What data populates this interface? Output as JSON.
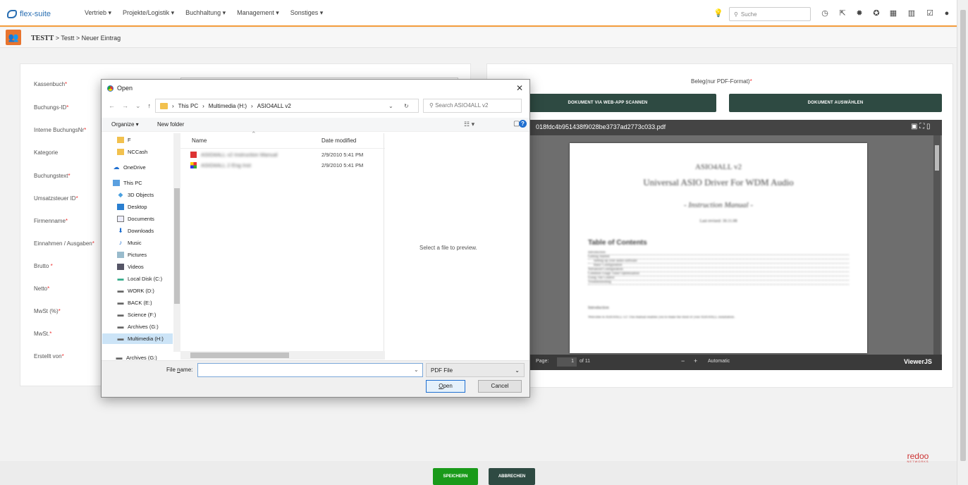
{
  "app": {
    "logo_text": "flex-suite",
    "menu": [
      "Vertrieb ▾",
      "Projekte/Logistik ▾",
      "Buchhaltung ▾",
      "Management ▾",
      "Sonstiges ▾"
    ],
    "search_placeholder": "Suche"
  },
  "breadcrumb": {
    "module": "TESTT",
    "trail": " > Testt > Neuer Eintrag"
  },
  "form": {
    "labels": [
      "Kassenbuch",
      "Buchungs-ID",
      "Interne BuchungsNr",
      "Kategorie",
      "Buchungstext",
      "Umsatzsteuer ID",
      "Firmenname",
      "Einnahmen / Ausgaben",
      "Brutto ",
      "Netto",
      "MwSt (%)",
      "MwSt.",
      "Erstellt von"
    ],
    "required_marker": "*"
  },
  "beleg": {
    "label": "Beleg(nur PDF-Format)",
    "scan_button": "DOKUMENT VIA WEB-APP SCANNEN",
    "select_button": "DOKUMENT AUSWÄHLEN"
  },
  "viewer": {
    "filename": "018fdc4b951438f9028be3737ad2773c033.pdf",
    "page_label": "Page:",
    "page_num": "1",
    "page_of": "of 11",
    "zoom": "Automatic",
    "brand": "ViewerJS",
    "doc_title1": "ASIO4ALL v2",
    "doc_title2": "Universal ASIO Driver For WDM Audio",
    "doc_subtitle": "- Instruction Manual -",
    "doc_revised": "Last revised: 30.11.08",
    "toc_heading": "Table of Contents",
    "toc_lines": [
      "Introduction",
      "Getting Started",
      "Setting up your audio software",
      "Basic Configuration",
      "Advanced Configuration",
      "Common Usage Tuner Optimization",
      "Using The Control",
      "Troubleshooting"
    ],
    "intro_heading": "Introduction",
    "intro_text": "Welcome to ASIO4ALL v2! This manual enables you to make the most of your ASIO4ALL installation."
  },
  "dialog": {
    "title": "Open",
    "path": [
      "This PC",
      "Multimedia (H:)",
      "ASIO4ALL v2"
    ],
    "search_placeholder": "Search ASIO4ALL v2",
    "organize": "Organize ▾",
    "new_folder": "New folder",
    "col_name": "Name",
    "col_date": "Date modified",
    "tree": [
      "F",
      "NCCash",
      "OneDrive",
      "This PC",
      "3D Objects",
      "Desktop",
      "Documents",
      "Downloads",
      "Music",
      "Pictures",
      "Videos",
      "Local Disk (C:)",
      "WORK (D:)",
      "BACK (E:)",
      "Science (F:)",
      "Archives (G:)",
      "Multimedia (H:)"
    ],
    "tree_footer": "Archives (G:)",
    "files": [
      {
        "name": "ASIO4ALL v2 Instruction Manual",
        "date": "2/9/2010 5:41 PM"
      },
      {
        "name": "ASIO4ALL 2 Eng Inst",
        "date": "2/9/2010 5:41 PM"
      }
    ],
    "preview_text": "Select a file to preview.",
    "filename_label_pre": "File ",
    "filename_label_u": "n",
    "filename_label_post": "ame:",
    "filetype": "PDF File",
    "open_btn_u": "O",
    "open_btn_rest": "pen",
    "cancel_btn": "Cancel"
  },
  "footer": {
    "save": "SPEICHERN",
    "cancel": "ABBRECHEN",
    "brand": "redoo",
    "brand_sub": "NETWORKS"
  },
  "colors": {
    "accent": "#f39c3c",
    "dark_button": "#2e4a42",
    "save_green": "#1a9a1a"
  }
}
